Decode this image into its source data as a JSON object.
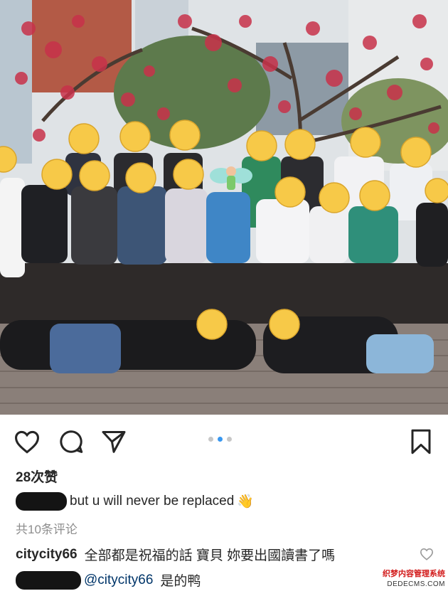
{
  "post": {
    "like_count": "28次赞",
    "caption_text": "but u will never be replaced",
    "caption_emoji": "👋",
    "view_comments": "共10条评论",
    "carousel": {
      "total": 3,
      "active_index": 1
    }
  },
  "comments": [
    {
      "user": "citycity66",
      "text": "全部都是祝福的話 寶貝 妳要出國讀書了嗎"
    },
    {
      "mention": "@citycity66",
      "text": "是的鸭"
    }
  ],
  "icons": [
    "heart-icon",
    "comment-icon",
    "share-icon",
    "bookmark-icon",
    "heart-small-icon"
  ],
  "colors": {
    "blossom": "#c8324a",
    "sky": "#d9dde0",
    "deck": "#8a7f79",
    "emoji_face": "#f7c948",
    "carousel_active": "#3897f0"
  },
  "watermark": {
    "line1": "织梦内容管理系统",
    "line2": "DEDECMS.COM"
  }
}
